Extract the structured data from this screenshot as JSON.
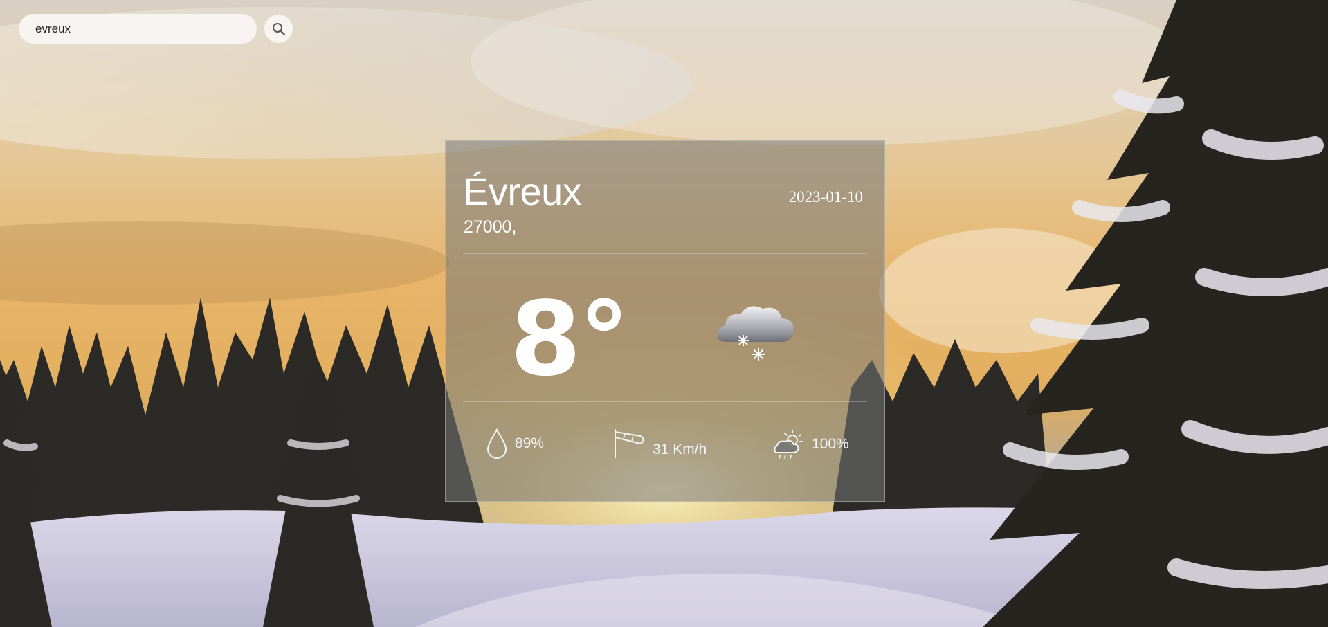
{
  "search": {
    "value": "evreux",
    "placeholder": "",
    "button_icon": "search-icon"
  },
  "weather": {
    "city": "Évreux",
    "postal": "27000,",
    "date": "2023-01-10",
    "temperature": "8°",
    "condition_icon": "snow-cloud-icon",
    "humidity": {
      "icon": "droplet-icon",
      "value": "89%"
    },
    "wind": {
      "icon": "windsock-icon",
      "value": "31 Km/h"
    },
    "clouds": {
      "icon": "partly-cloudy-sun-icon",
      "value": "100%"
    }
  },
  "colors": {
    "card_bg": "#767676",
    "text": "#ffffff",
    "search_bg": "#f7f4f2"
  }
}
